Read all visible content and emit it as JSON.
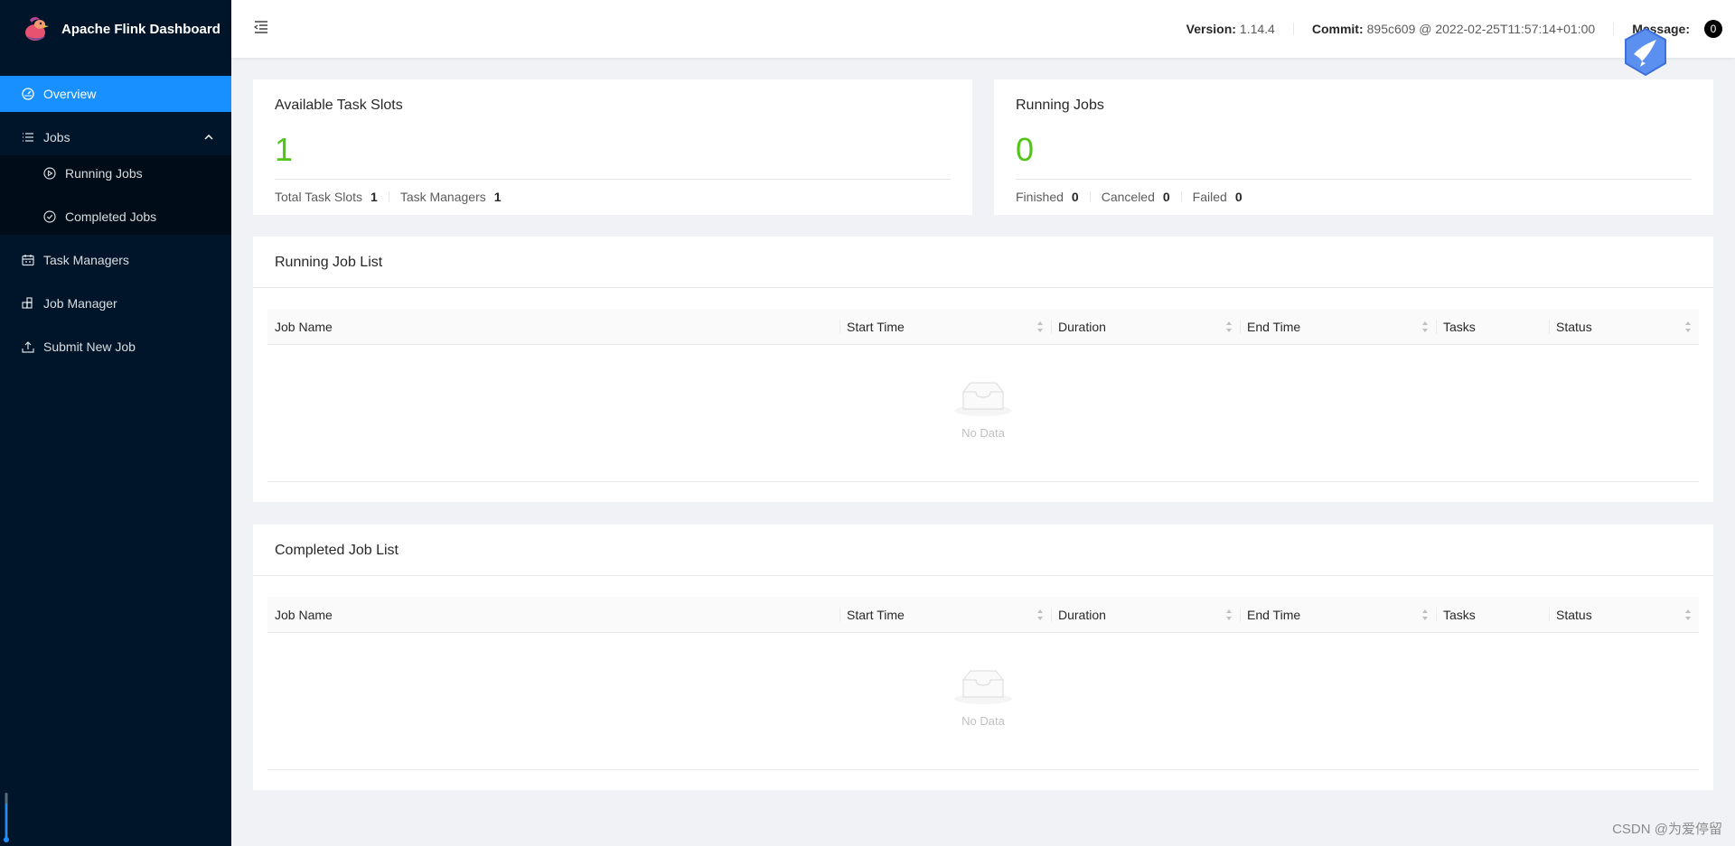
{
  "app": {
    "title": "Apache Flink Dashboard"
  },
  "sidebar": {
    "items": [
      {
        "label": "Overview",
        "icon": "dashboard-icon",
        "active": true
      },
      {
        "label": "Jobs",
        "icon": "list-icon",
        "expanded": true,
        "children": [
          {
            "label": "Running Jobs",
            "icon": "play-circle-icon"
          },
          {
            "label": "Completed Jobs",
            "icon": "check-circle-icon"
          }
        ]
      },
      {
        "label": "Task Managers",
        "icon": "schedule-icon"
      },
      {
        "label": "Job Manager",
        "icon": "build-icon"
      },
      {
        "label": "Submit New Job",
        "icon": "upload-icon"
      }
    ]
  },
  "header": {
    "version_label": "Version:",
    "version": "1.14.4",
    "commit_label": "Commit:",
    "commit": "895c609 @ 2022-02-25T11:57:14+01:00",
    "message_label": "Message:",
    "message_count": "0"
  },
  "task_slots": {
    "title": "Available Task Slots",
    "value": "1",
    "total_label": "Total Task Slots",
    "total": "1",
    "tm_label": "Task Managers",
    "tm": "1"
  },
  "running_jobs": {
    "title": "Running Jobs",
    "value": "0",
    "finished_label": "Finished",
    "finished": "0",
    "canceled_label": "Canceled",
    "canceled": "0",
    "failed_label": "Failed",
    "failed": "0"
  },
  "running_list": {
    "title": "Running Job List",
    "columns": [
      "Job Name",
      "Start Time",
      "Duration",
      "End Time",
      "Tasks",
      "Status"
    ],
    "empty_text": "No Data"
  },
  "completed_list": {
    "title": "Completed Job List",
    "columns": [
      "Job Name",
      "Start Time",
      "Duration",
      "End Time",
      "Tasks",
      "Status"
    ],
    "empty_text": "No Data"
  },
  "watermark": "CSDN @为爱停留",
  "colors": {
    "sidebar_bg": "#001529",
    "submenu_bg": "#000c17",
    "active": "#1890ff",
    "stat_value": "#52c41a"
  }
}
